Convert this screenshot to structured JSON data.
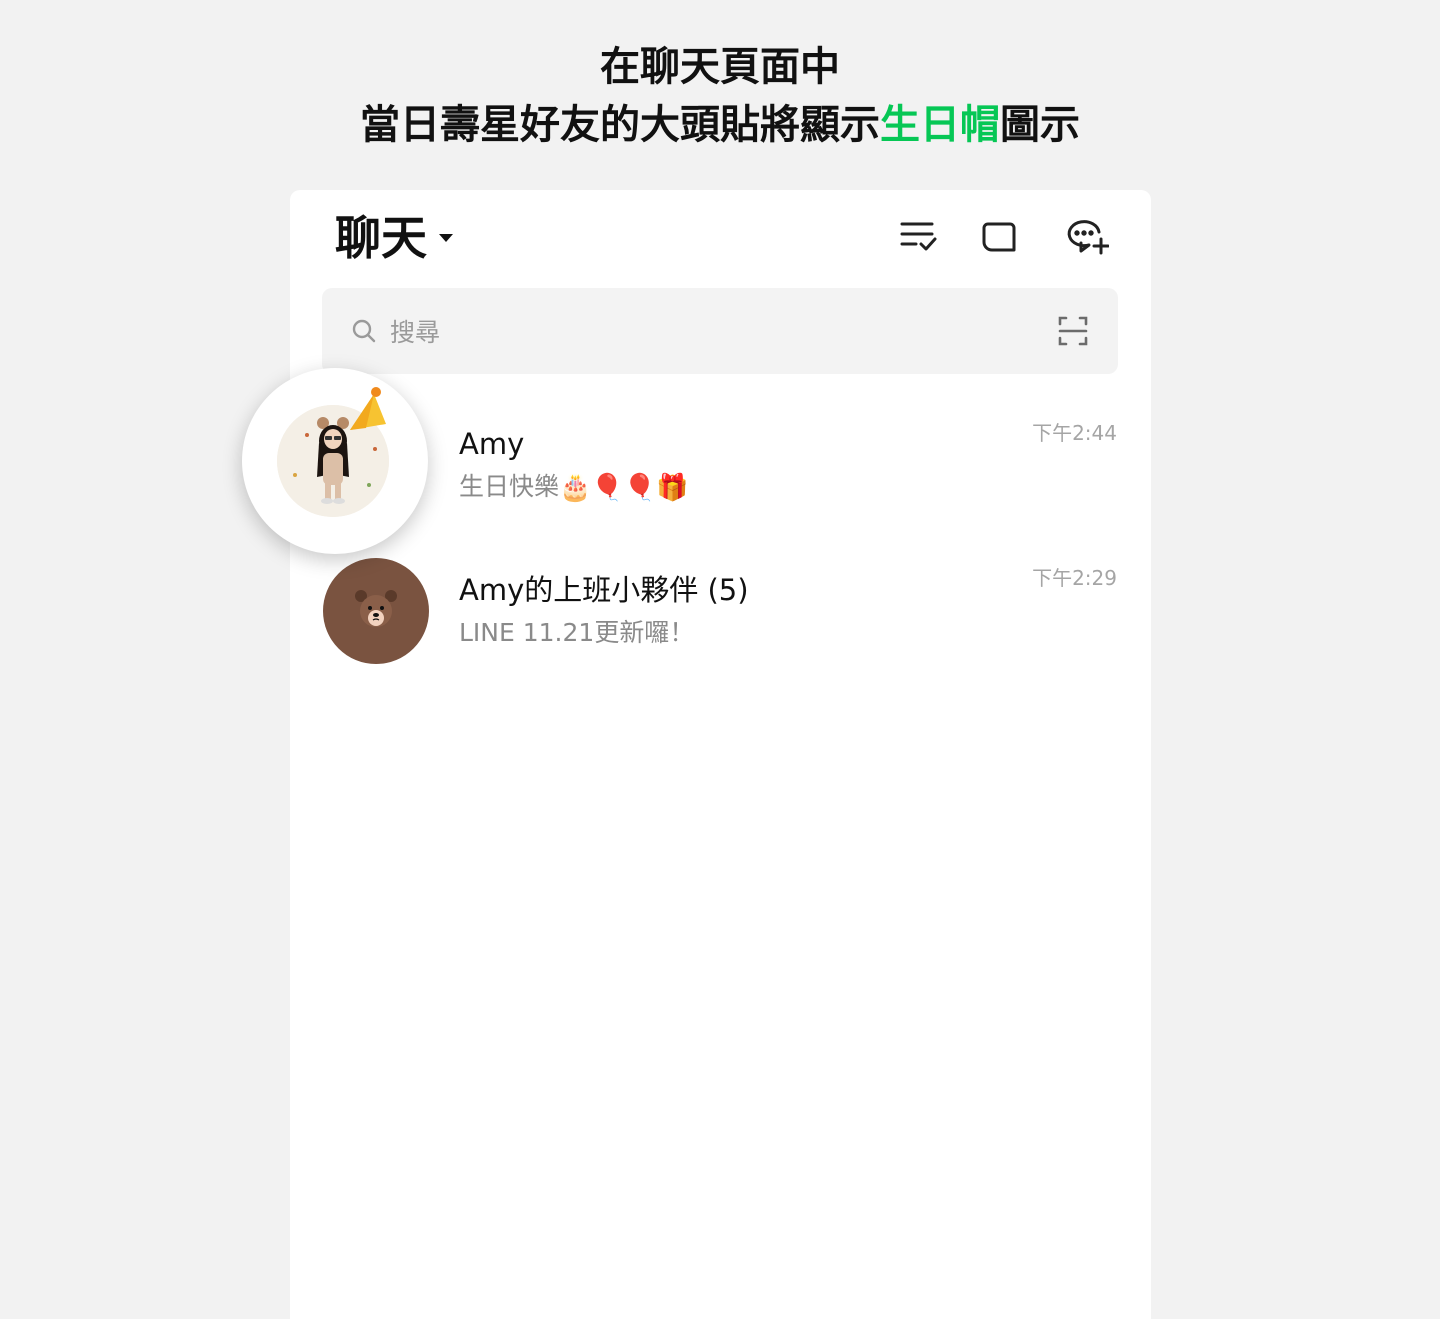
{
  "headline": {
    "line1": "在聊天頁面中",
    "line2_prefix": "當日壽星好友的大頭貼將顯示",
    "line2_highlight": "生日帽",
    "line2_suffix": "圖示",
    "highlight_color": "#06c755"
  },
  "header": {
    "title": "聊天",
    "icons": [
      "edit-chats-icon",
      "keep-icon",
      "new-chat-icon"
    ]
  },
  "search": {
    "placeholder": "搜尋",
    "value": ""
  },
  "chats": [
    {
      "name": "Amy",
      "preview_text": "生日快樂",
      "preview_emoji": "🎂🎈🎈🎁",
      "time": "下午2:44",
      "avatar_badge": "party-hat-icon"
    },
    {
      "name": "Amy的上班小夥伴 (5)",
      "preview_text": "LINE 11.21更新囉！",
      "time": "下午2:29",
      "avatar": "brown-bear-icon"
    }
  ]
}
